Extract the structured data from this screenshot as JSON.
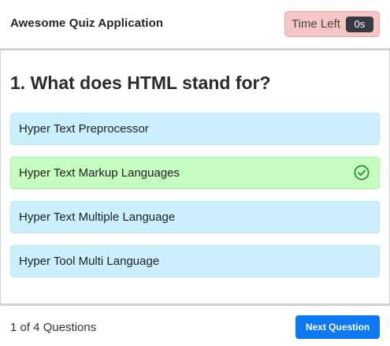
{
  "header": {
    "app_title": "Awesome Quiz Application",
    "timer_label": "Time Left",
    "timer_value": "0s"
  },
  "question": {
    "title": "1. What does HTML stand for?",
    "options": [
      {
        "label": "Hyper Text Preprocessor",
        "state": "default"
      },
      {
        "label": "Hyper Text Markup Languages",
        "state": "correct",
        "icon": "check-circle-icon"
      },
      {
        "label": "Hyper Text Multiple Language",
        "state": "default"
      },
      {
        "label": "Hyper Tool Multi Language",
        "state": "default"
      }
    ]
  },
  "footer": {
    "counter": "1 of 4 Questions",
    "next_label": "Next Question"
  },
  "colors": {
    "option_default": "#cceffd",
    "option_correct": "#c5fcc0",
    "correct_icon": "#1e8e2e",
    "timer_bg": "#f6c6c7",
    "timer_value_bg": "#343a40",
    "button": "#0d78f2"
  }
}
